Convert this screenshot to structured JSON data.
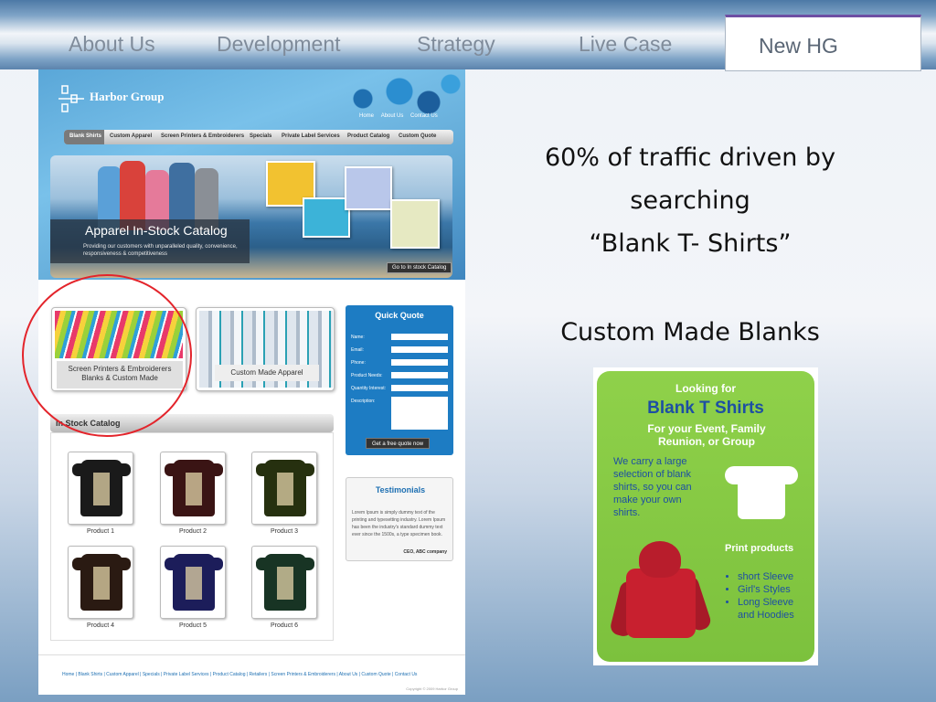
{
  "tabs": [
    "About Us",
    "Development",
    "Strategy",
    "Live Case"
  ],
  "active_tab": "New HG",
  "site": {
    "brand": "Harbor Group",
    "top_links": [
      "Home",
      "About Us",
      "Contact Us"
    ],
    "nav": [
      "Blank Shirts",
      "Custom Apparel",
      "Screen Printers & Embroiderers",
      "Specials",
      "Private Label Services",
      "Product Catalog",
      "Custom Quote"
    ],
    "hero_title": "Apparel In-Stock Catalog",
    "hero_sub": "Providing our customers with unparalleled quality, convenience, responsiveness & competitiveness",
    "hero_button": "Go to In stock Catalog",
    "promo1": "Screen Printers & Embroiderers Blanks & Custom Made",
    "promo2": "Custom Made Apparel",
    "quote": {
      "title": "Quick Quote",
      "fields": [
        "Name:",
        "Email:",
        "Phone:",
        "Product Needs:",
        "Quantity Interest:",
        "Description:"
      ],
      "button": "Get a free quote now"
    },
    "catalog_title": "In Stock Catalog",
    "products": [
      "Product 1",
      "Product 2",
      "Product 3",
      "Product 4",
      "Product 5",
      "Product 6"
    ],
    "testimonials": {
      "title": "Testimonials",
      "text": "Lorem Ipsum is simply dummy text of the printing and typesetting industry. Lorem Ipsum has been the industry's standard dummy text ever since the 1500s, a type specimen book.",
      "author": "CEO, ABC company"
    },
    "footer_links": "Home | Blank Shirts | Custom Apparel | Specials | Private Label Services | Product Catalog | Retailers | Screen Printers & Embroiderers | About Us | Custom Quote | Contact Us",
    "copyright": "Copyright © 2009 Harbor Group"
  },
  "right": {
    "line1": "60% of traffic driven by",
    "line2": "searching",
    "line3": "“Blank T- Shirts”",
    "line4": "Custom Made Blanks"
  },
  "ad": {
    "t1": "Looking for",
    "t2": "Blank T Shirts",
    "t3": "For your Event, Family Reunion, or Group",
    "t4": "We carry a large selection of blank shirts, so you can make your own shirts.",
    "t5": "Print products",
    "list": [
      "short Sleeve",
      "Girl's Styles",
      "Long Sleeve",
      "and Hoodies"
    ]
  },
  "colors": {
    "tee1": "#1a1a1a",
    "tee2": "#3a1414",
    "tee3": "#26300f",
    "tee4": "#2a1a12",
    "tee5": "#1c1d5a",
    "tee6": "#183424"
  }
}
